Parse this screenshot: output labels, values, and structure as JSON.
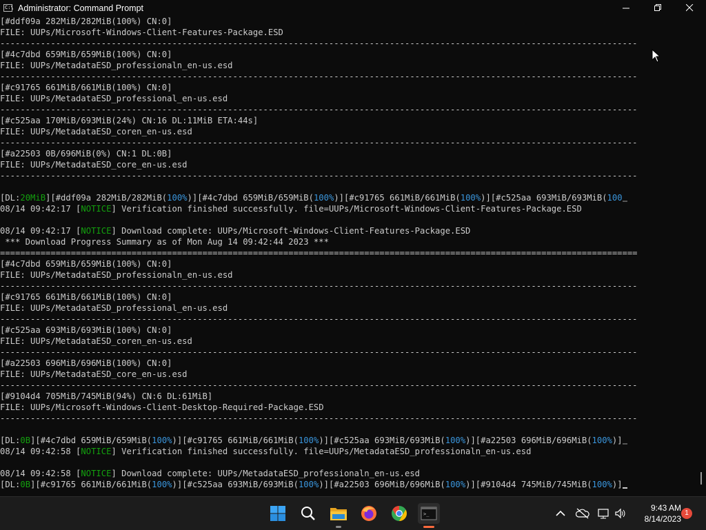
{
  "window": {
    "title": "Administrator: Command Prompt"
  },
  "terminal": {
    "lines": [
      {
        "segs": [
          {
            "t": "[#ddf09a 282MiB/282MiB(100%) CN:0]"
          }
        ]
      },
      {
        "segs": [
          {
            "t": "FILE: UUPs/Microsoft-Windows-Client-Features-Package.ESD"
          }
        ]
      },
      {
        "segs": [
          {
            "t": "------------------------------------------------------------------------------------------------------------------------------"
          }
        ]
      },
      {
        "segs": [
          {
            "t": "[#4c7dbd 659MiB/659MiB(100%) CN:0]"
          }
        ]
      },
      {
        "segs": [
          {
            "t": "FILE: UUPs/MetadataESD_professionaln_en-us.esd"
          }
        ]
      },
      {
        "segs": [
          {
            "t": "------------------------------------------------------------------------------------------------------------------------------"
          }
        ]
      },
      {
        "segs": [
          {
            "t": "[#c91765 661MiB/661MiB(100%) CN:0]"
          }
        ]
      },
      {
        "segs": [
          {
            "t": "FILE: UUPs/MetadataESD_professional_en-us.esd"
          }
        ]
      },
      {
        "segs": [
          {
            "t": "------------------------------------------------------------------------------------------------------------------------------"
          }
        ]
      },
      {
        "segs": [
          {
            "t": "[#c525aa 170MiB/693MiB(24%) CN:16 DL:11MiB ETA:44s]"
          }
        ]
      },
      {
        "segs": [
          {
            "t": "FILE: UUPs/MetadataESD_coren_en-us.esd"
          }
        ]
      },
      {
        "segs": [
          {
            "t": "------------------------------------------------------------------------------------------------------------------------------"
          }
        ]
      },
      {
        "segs": [
          {
            "t": "[#a22503 0B/696MiB(0%) CN:1 DL:0B]"
          }
        ]
      },
      {
        "segs": [
          {
            "t": "FILE: UUPs/MetadataESD_core_en-us.esd"
          }
        ]
      },
      {
        "segs": [
          {
            "t": "------------------------------------------------------------------------------------------------------------------------------"
          }
        ]
      },
      {
        "segs": []
      },
      {
        "segs": [
          {
            "t": "[DL:"
          },
          {
            "t": "20MiB",
            "c": "g"
          },
          {
            "t": "][#ddf09a 282MiB/282MiB("
          },
          {
            "t": "100%",
            "c": "c"
          },
          {
            "t": ")][#4c7dbd 659MiB/659MiB("
          },
          {
            "t": "100%",
            "c": "c"
          },
          {
            "t": ")][#c91765 661MiB/661MiB("
          },
          {
            "t": "100%",
            "c": "c"
          },
          {
            "t": ")][#c525aa 693MiB/693MiB("
          },
          {
            "t": "100",
            "c": "c"
          }
        ],
        "tail": true
      },
      {
        "segs": [
          {
            "t": "08/14 09:42:17 ["
          },
          {
            "t": "NOTICE",
            "c": "g"
          },
          {
            "t": "] Verification finished successfully. file=UUPs/Microsoft-Windows-Client-Features-Package.ESD"
          }
        ]
      },
      {
        "segs": []
      },
      {
        "segs": [
          {
            "t": "08/14 09:42:17 ["
          },
          {
            "t": "NOTICE",
            "c": "g"
          },
          {
            "t": "] Download complete: UUPs/Microsoft-Windows-Client-Features-Package.ESD"
          }
        ]
      },
      {
        "segs": [
          {
            "t": " *** Download Progress Summary as of Mon Aug 14 09:42:44 2023 ***"
          }
        ]
      },
      {
        "segs": [
          {
            "t": "=============================================================================================================================="
          }
        ]
      },
      {
        "segs": [
          {
            "t": "[#4c7dbd 659MiB/659MiB(100%) CN:0]"
          }
        ]
      },
      {
        "segs": [
          {
            "t": "FILE: UUPs/MetadataESD_professionaln_en-us.esd"
          }
        ]
      },
      {
        "segs": [
          {
            "t": "------------------------------------------------------------------------------------------------------------------------------"
          }
        ]
      },
      {
        "segs": [
          {
            "t": "[#c91765 661MiB/661MiB(100%) CN:0]"
          }
        ]
      },
      {
        "segs": [
          {
            "t": "FILE: UUPs/MetadataESD_professional_en-us.esd"
          }
        ]
      },
      {
        "segs": [
          {
            "t": "------------------------------------------------------------------------------------------------------------------------------"
          }
        ]
      },
      {
        "segs": [
          {
            "t": "[#c525aa 693MiB/693MiB(100%) CN:0]"
          }
        ]
      },
      {
        "segs": [
          {
            "t": "FILE: UUPs/MetadataESD_coren_en-us.esd"
          }
        ]
      },
      {
        "segs": [
          {
            "t": "------------------------------------------------------------------------------------------------------------------------------"
          }
        ]
      },
      {
        "segs": [
          {
            "t": "[#a22503 696MiB/696MiB(100%) CN:0]"
          }
        ]
      },
      {
        "segs": [
          {
            "t": "FILE: UUPs/MetadataESD_core_en-us.esd"
          }
        ]
      },
      {
        "segs": [
          {
            "t": "------------------------------------------------------------------------------------------------------------------------------"
          }
        ]
      },
      {
        "segs": [
          {
            "t": "[#9104d4 705MiB/745MiB(94%) CN:6 DL:61MiB]"
          }
        ]
      },
      {
        "segs": [
          {
            "t": "FILE: UUPs/Microsoft-Windows-Client-Desktop-Required-Package.ESD"
          }
        ]
      },
      {
        "segs": [
          {
            "t": "------------------------------------------------------------------------------------------------------------------------------"
          }
        ]
      },
      {
        "segs": []
      },
      {
        "segs": [
          {
            "t": "[DL:"
          },
          {
            "t": "0B",
            "c": "g"
          },
          {
            "t": "][#4c7dbd 659MiB/659MiB("
          },
          {
            "t": "100%",
            "c": "c"
          },
          {
            "t": ")][#c91765 661MiB/661MiB("
          },
          {
            "t": "100%",
            "c": "c"
          },
          {
            "t": ")][#c525aa 693MiB/693MiB("
          },
          {
            "t": "100%",
            "c": "c"
          },
          {
            "t": ")][#a22503 696MiB/696MiB("
          },
          {
            "t": "100%",
            "c": "c"
          },
          {
            "t": ")]"
          }
        ],
        "tail": true
      },
      {
        "segs": [
          {
            "t": "08/14 09:42:58 ["
          },
          {
            "t": "NOTICE",
            "c": "g"
          },
          {
            "t": "] Verification finished successfully. file=UUPs/MetadataESD_professionaln_en-us.esd"
          }
        ]
      },
      {
        "segs": []
      },
      {
        "segs": [
          {
            "t": "08/14 09:42:58 ["
          },
          {
            "t": "NOTICE",
            "c": "g"
          },
          {
            "t": "] Download complete: UUPs/MetadataESD_professionaln_en-us.esd"
          }
        ]
      },
      {
        "segs": [
          {
            "t": "[DL:"
          },
          {
            "t": "0B",
            "c": "g"
          },
          {
            "t": "][#c91765 661MiB/661MiB("
          },
          {
            "t": "100%",
            "c": "c"
          },
          {
            "t": ")][#c525aa 693MiB/693MiB("
          },
          {
            "t": "100%",
            "c": "c"
          },
          {
            "t": ")][#a22503 696MiB/696MiB("
          },
          {
            "t": "100%",
            "c": "c"
          },
          {
            "t": ")][#9104d4 745MiB/745MiB("
          },
          {
            "t": "100%",
            "c": "c"
          },
          {
            "t": ")]"
          }
        ],
        "cursor": true
      }
    ]
  },
  "taskbar": {
    "pinned": [
      "start-icon",
      "search-icon",
      "file-explorer-icon",
      "firefox-icon",
      "chrome-icon",
      "terminal-icon"
    ],
    "clock_time": "9:43 AM",
    "clock_date": "8/14/2023",
    "notification_count": "1"
  },
  "colors": {
    "green": "#13a10e",
    "cyan": "#3a96dd",
    "text": "#cccccc",
    "background": "#0c0c0c",
    "taskbar": "#1c1c1c",
    "badge": "#e74a3b"
  }
}
